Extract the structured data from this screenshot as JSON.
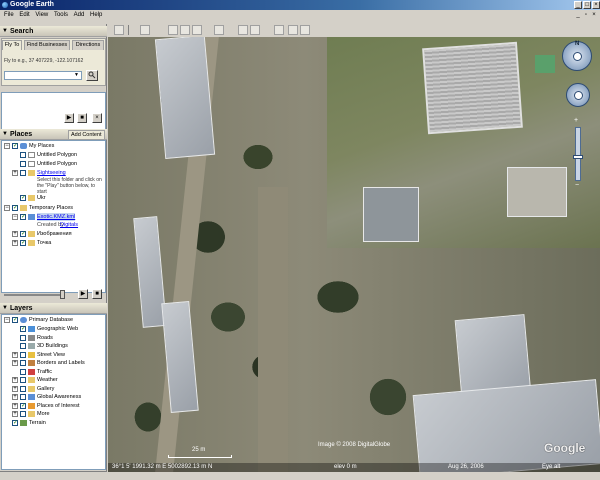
{
  "window": {
    "title": "Google Earth"
  },
  "menu": [
    "File",
    "Edit",
    "View",
    "Tools",
    "Add",
    "Help"
  ],
  "search": {
    "header": "Search",
    "tabs": [
      "Fly To",
      "Find Businesses",
      "Directions"
    ],
    "hint": "Fly to e.g., 37 407229, -122.107162"
  },
  "places": {
    "header": "Places",
    "add_content": "Add Content",
    "my_places": "My Places",
    "untitled1": "Untitled Polygon",
    "untitled2": "Untitled Polygon",
    "sightseeing": "Sightseeing",
    "sightseeing_hint": "Select this folder and click on the \"Play\" button below, to start",
    "ukr": "Ukr",
    "temporary": "Temporary Places",
    "kmz_link": "Exotic.KMZ.kml",
    "created_by_label": "Created by",
    "created_by_link": "Digitals",
    "folder1": "Изображения",
    "folder2": "Точка"
  },
  "layers": {
    "header": "Layers",
    "primary": "Primary Database",
    "items": [
      "Geographic Web",
      "Roads",
      "3D Buildings",
      "Street View",
      "Borders and Labels",
      "Traffic",
      "Weather",
      "Gallery",
      "Global Awareness",
      "Places of Interest",
      "More",
      "Terrain"
    ],
    "checked": [
      true,
      false,
      false,
      false,
      false,
      false,
      false,
      false,
      false,
      true,
      false,
      true
    ]
  },
  "map": {
    "scale_label": "25 m",
    "copyright": "Image © 2008 DigitalGlobe",
    "coords": "36°1 5' 1991.32 m E 5002892.13 m N",
    "elev": "elev 0 m",
    "date": "Aug 26, 2006",
    "eye_alt": "Eye alt",
    "logo": "Google"
  }
}
